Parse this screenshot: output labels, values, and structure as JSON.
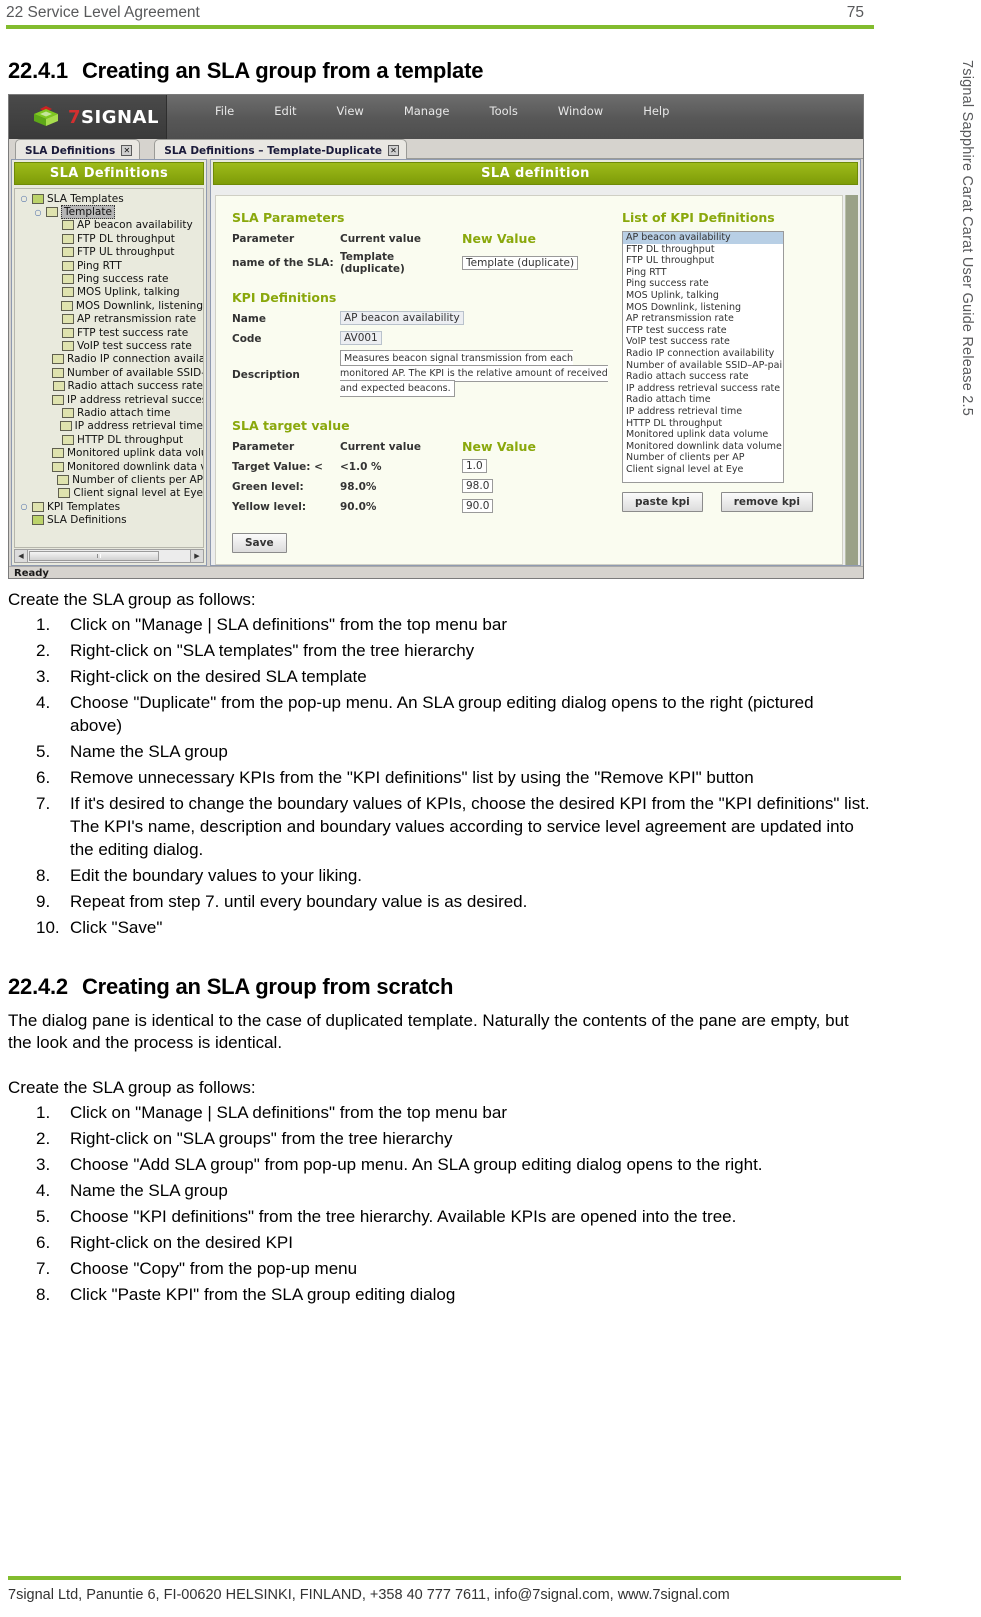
{
  "header": {
    "chapter": "22 Service Level Agreement",
    "page_number": "75"
  },
  "side_title": "7signal Sapphire Carat Carat User Guide Release 2.5",
  "colors": {
    "brand_green": "#82bc2e",
    "panel_green": "#8aa80c",
    "header_gray": "#58595b"
  },
  "sections": [
    {
      "number": "22.4.1",
      "title": "Creating an SLA group from a template",
      "lead": "Create the SLA group as follows:",
      "steps": [
        "Click on \"Manage | SLA definitions\" from the top menu bar",
        "Right-click on \"SLA templates\" from the tree hierarchy",
        "Right-click on the desired SLA template",
        "Choose \"Duplicate\" from the pop-up menu. An SLA group editing dialog opens to the right (pictured above)",
        "Name the SLA group",
        "Remove unnecessary KPIs from the \"KPI definitions\" list by using the \"Remove KPI\" button",
        "If it's desired to change the boundary values of KPIs, choose the desired KPI from the \"KPI definitions\" list. The KPI's name, description and boundary values according to service level agreement are updated into the editing dialog.",
        "Edit the boundary values to your liking.",
        "Repeat from step 7. until every boundary value is as desired.",
        "Click \"Save\""
      ]
    },
    {
      "number": "22.4.2",
      "title": "Creating an SLA group from scratch",
      "intro": "The dialog pane is identical to the case of duplicated template. Naturally the contents of the pane are empty, but the look and the process is identical.",
      "lead": "Create the SLA group as follows:",
      "steps": [
        "Click on \"Manage | SLA definitions\" from the top menu bar",
        "Right-click on \"SLA groups\" from the tree hierarchy",
        "Choose \"Add SLA group\" from pop-up menu. An SLA group editing dialog opens to the right.",
        "Name the SLA group",
        "Choose \"KPI definitions\" from the tree hierarchy. Available KPIs are opened into the tree.",
        "Right-click on the desired KPI",
        "Choose \"Copy\" from the pop-up menu",
        "Click \"Paste KPI\" from the SLA group editing dialog"
      ]
    }
  ],
  "screenshot": {
    "logo": {
      "seven": "7",
      "word": "SIGNAL"
    },
    "menu": [
      "File",
      "Edit",
      "View",
      "Manage",
      "Tools",
      "Window",
      "Help"
    ],
    "tabs": [
      {
        "label": "SLA Definitions",
        "close": "✕"
      },
      {
        "label": "SLA Definitions – Template-Duplicate",
        "close": "✕"
      }
    ],
    "tree_pane": {
      "title": "SLA Definitions",
      "nodes": [
        {
          "level": 1,
          "label": "SLA Templates",
          "hinge": "○",
          "icon": "sla",
          "selected": false
        },
        {
          "level": 2,
          "label": "Template",
          "hinge": "○",
          "icon": "kpi",
          "selected": true
        },
        {
          "level": 3,
          "label": "AP beacon availability",
          "hinge": "",
          "icon": "kpi",
          "selected": false
        },
        {
          "level": 3,
          "label": "FTP DL throughput",
          "hinge": "",
          "icon": "kpi",
          "selected": false
        },
        {
          "level": 3,
          "label": "FTP UL throughput",
          "hinge": "",
          "icon": "kpi",
          "selected": false
        },
        {
          "level": 3,
          "label": "Ping RTT",
          "hinge": "",
          "icon": "kpi",
          "selected": false
        },
        {
          "level": 3,
          "label": "Ping success rate",
          "hinge": "",
          "icon": "kpi",
          "selected": false
        },
        {
          "level": 3,
          "label": "MOS Uplink, talking",
          "hinge": "",
          "icon": "kpi",
          "selected": false
        },
        {
          "level": 3,
          "label": "MOS Downlink, listening",
          "hinge": "",
          "icon": "kpi",
          "selected": false
        },
        {
          "level": 3,
          "label": "AP retransmission rate",
          "hinge": "",
          "icon": "kpi",
          "selected": false
        },
        {
          "level": 3,
          "label": "FTP test success rate",
          "hinge": "",
          "icon": "kpi",
          "selected": false
        },
        {
          "level": 3,
          "label": "VoIP test success rate",
          "hinge": "",
          "icon": "kpi",
          "selected": false
        },
        {
          "level": 3,
          "label": "Radio IP connection availability",
          "hinge": "",
          "icon": "kpi",
          "selected": false
        },
        {
          "level": 3,
          "label": "Number of available SSID–AP-p",
          "hinge": "",
          "icon": "kpi",
          "selected": false
        },
        {
          "level": 3,
          "label": "Radio attach success rate",
          "hinge": "",
          "icon": "kpi",
          "selected": false
        },
        {
          "level": 3,
          "label": "IP address retrieval success rate",
          "hinge": "",
          "icon": "kpi",
          "selected": false
        },
        {
          "level": 3,
          "label": "Radio attach time",
          "hinge": "",
          "icon": "kpi",
          "selected": false
        },
        {
          "level": 3,
          "label": "IP address retrieval time",
          "hinge": "",
          "icon": "kpi",
          "selected": false
        },
        {
          "level": 3,
          "label": "HTTP DL throughput",
          "hinge": "",
          "icon": "kpi",
          "selected": false
        },
        {
          "level": 3,
          "label": "Monitored uplink data volume",
          "hinge": "",
          "icon": "kpi",
          "selected": false
        },
        {
          "level": 3,
          "label": "Monitored downlink data volum",
          "hinge": "",
          "icon": "kpi",
          "selected": false
        },
        {
          "level": 3,
          "label": "Number of clients per AP",
          "hinge": "",
          "icon": "kpi",
          "selected": false
        },
        {
          "level": 3,
          "label": "Client signal level at Eye",
          "hinge": "",
          "icon": "kpi",
          "selected": false
        },
        {
          "level": 1,
          "label": "KPI Templates",
          "hinge": "○",
          "icon": "kpi",
          "selected": false
        },
        {
          "level": 1,
          "label": "SLA Definitions",
          "hinge": "",
          "icon": "sla",
          "selected": false
        }
      ]
    },
    "def_pane": {
      "title": "SLA definition",
      "sla_parameters": {
        "group_title": "SLA Parameters",
        "col_parameter": "Parameter",
        "col_current": "Current value",
        "col_new": "New Value",
        "rows": [
          {
            "parameter": "name of the SLA:",
            "current": "Template (duplicate)",
            "new": "Template (duplicate)"
          }
        ]
      },
      "kpi_definitions": {
        "group_title": "KPI Definitions",
        "name_label": "Name",
        "name_value": "AP beacon availability",
        "code_label": "Code",
        "code_value": "AV001",
        "description_label": "Description",
        "description_value": "Measures beacon signal transmission from each monitored AP. The KPI is the relative amount of received and expected beacons."
      },
      "sla_target_value": {
        "group_title": "SLA target value",
        "col_parameter": "Parameter",
        "col_current": "Current value",
        "col_new": "New Value",
        "rows": [
          {
            "parameter": "Target Value: <",
            "current": "<1.0 %",
            "new": "1.0"
          },
          {
            "parameter": "Green level:",
            "current": "98.0%",
            "new": "98.0"
          },
          {
            "parameter": "Yellow level:",
            "current": "90.0%",
            "new": "90.0"
          }
        ]
      },
      "save_button": "Save",
      "kpi_list": {
        "title": "List of KPI Definitions",
        "items": [
          "AP beacon availability",
          "FTP DL throughput",
          "FTP UL throughput",
          "Ping RTT",
          "Ping success rate",
          "MOS Uplink, talking",
          "MOS Downlink, listening",
          "AP retransmission rate",
          "FTP test success rate",
          "VoIP test success rate",
          "Radio IP connection availability",
          "Number of available SSID–AP-pairs",
          "Radio attach success rate",
          "IP address retrieval success rate",
          "Radio attach time",
          "IP address retrieval time",
          "HTTP DL throughput",
          "Monitored uplink data volume",
          "Monitored downlink data volume",
          "Number of clients per AP",
          "Client signal level at Eye"
        ],
        "selected_index": 0,
        "paste_button": "paste kpi",
        "remove_button": "remove kpi"
      }
    },
    "statusbar": "Ready"
  },
  "footer": "7signal Ltd, Panuntie 6, FI-00620 HELSINKI, FINLAND, +358 40 777 7611, info@7signal.com, www.7signal.com"
}
